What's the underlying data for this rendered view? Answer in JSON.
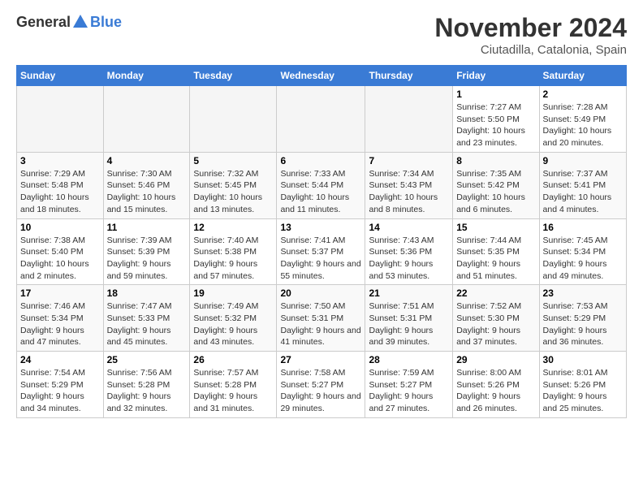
{
  "header": {
    "logo_general": "General",
    "logo_blue": "Blue",
    "month": "November 2024",
    "location": "Ciutadilla, Catalonia, Spain"
  },
  "weekdays": [
    "Sunday",
    "Monday",
    "Tuesday",
    "Wednesday",
    "Thursday",
    "Friday",
    "Saturday"
  ],
  "weeks": [
    [
      {
        "day": "",
        "info": ""
      },
      {
        "day": "",
        "info": ""
      },
      {
        "day": "",
        "info": ""
      },
      {
        "day": "",
        "info": ""
      },
      {
        "day": "",
        "info": ""
      },
      {
        "day": "1",
        "info": "Sunrise: 7:27 AM\nSunset: 5:50 PM\nDaylight: 10 hours and 23 minutes."
      },
      {
        "day": "2",
        "info": "Sunrise: 7:28 AM\nSunset: 5:49 PM\nDaylight: 10 hours and 20 minutes."
      }
    ],
    [
      {
        "day": "3",
        "info": "Sunrise: 7:29 AM\nSunset: 5:48 PM\nDaylight: 10 hours and 18 minutes."
      },
      {
        "day": "4",
        "info": "Sunrise: 7:30 AM\nSunset: 5:46 PM\nDaylight: 10 hours and 15 minutes."
      },
      {
        "day": "5",
        "info": "Sunrise: 7:32 AM\nSunset: 5:45 PM\nDaylight: 10 hours and 13 minutes."
      },
      {
        "day": "6",
        "info": "Sunrise: 7:33 AM\nSunset: 5:44 PM\nDaylight: 10 hours and 11 minutes."
      },
      {
        "day": "7",
        "info": "Sunrise: 7:34 AM\nSunset: 5:43 PM\nDaylight: 10 hours and 8 minutes."
      },
      {
        "day": "8",
        "info": "Sunrise: 7:35 AM\nSunset: 5:42 PM\nDaylight: 10 hours and 6 minutes."
      },
      {
        "day": "9",
        "info": "Sunrise: 7:37 AM\nSunset: 5:41 PM\nDaylight: 10 hours and 4 minutes."
      }
    ],
    [
      {
        "day": "10",
        "info": "Sunrise: 7:38 AM\nSunset: 5:40 PM\nDaylight: 10 hours and 2 minutes."
      },
      {
        "day": "11",
        "info": "Sunrise: 7:39 AM\nSunset: 5:39 PM\nDaylight: 9 hours and 59 minutes."
      },
      {
        "day": "12",
        "info": "Sunrise: 7:40 AM\nSunset: 5:38 PM\nDaylight: 9 hours and 57 minutes."
      },
      {
        "day": "13",
        "info": "Sunrise: 7:41 AM\nSunset: 5:37 PM\nDaylight: 9 hours and 55 minutes."
      },
      {
        "day": "14",
        "info": "Sunrise: 7:43 AM\nSunset: 5:36 PM\nDaylight: 9 hours and 53 minutes."
      },
      {
        "day": "15",
        "info": "Sunrise: 7:44 AM\nSunset: 5:35 PM\nDaylight: 9 hours and 51 minutes."
      },
      {
        "day": "16",
        "info": "Sunrise: 7:45 AM\nSunset: 5:34 PM\nDaylight: 9 hours and 49 minutes."
      }
    ],
    [
      {
        "day": "17",
        "info": "Sunrise: 7:46 AM\nSunset: 5:34 PM\nDaylight: 9 hours and 47 minutes."
      },
      {
        "day": "18",
        "info": "Sunrise: 7:47 AM\nSunset: 5:33 PM\nDaylight: 9 hours and 45 minutes."
      },
      {
        "day": "19",
        "info": "Sunrise: 7:49 AM\nSunset: 5:32 PM\nDaylight: 9 hours and 43 minutes."
      },
      {
        "day": "20",
        "info": "Sunrise: 7:50 AM\nSunset: 5:31 PM\nDaylight: 9 hours and 41 minutes."
      },
      {
        "day": "21",
        "info": "Sunrise: 7:51 AM\nSunset: 5:31 PM\nDaylight: 9 hours and 39 minutes."
      },
      {
        "day": "22",
        "info": "Sunrise: 7:52 AM\nSunset: 5:30 PM\nDaylight: 9 hours and 37 minutes."
      },
      {
        "day": "23",
        "info": "Sunrise: 7:53 AM\nSunset: 5:29 PM\nDaylight: 9 hours and 36 minutes."
      }
    ],
    [
      {
        "day": "24",
        "info": "Sunrise: 7:54 AM\nSunset: 5:29 PM\nDaylight: 9 hours and 34 minutes."
      },
      {
        "day": "25",
        "info": "Sunrise: 7:56 AM\nSunset: 5:28 PM\nDaylight: 9 hours and 32 minutes."
      },
      {
        "day": "26",
        "info": "Sunrise: 7:57 AM\nSunset: 5:28 PM\nDaylight: 9 hours and 31 minutes."
      },
      {
        "day": "27",
        "info": "Sunrise: 7:58 AM\nSunset: 5:27 PM\nDaylight: 9 hours and 29 minutes."
      },
      {
        "day": "28",
        "info": "Sunrise: 7:59 AM\nSunset: 5:27 PM\nDaylight: 9 hours and 27 minutes."
      },
      {
        "day": "29",
        "info": "Sunrise: 8:00 AM\nSunset: 5:26 PM\nDaylight: 9 hours and 26 minutes."
      },
      {
        "day": "30",
        "info": "Sunrise: 8:01 AM\nSunset: 5:26 PM\nDaylight: 9 hours and 25 minutes."
      }
    ]
  ]
}
